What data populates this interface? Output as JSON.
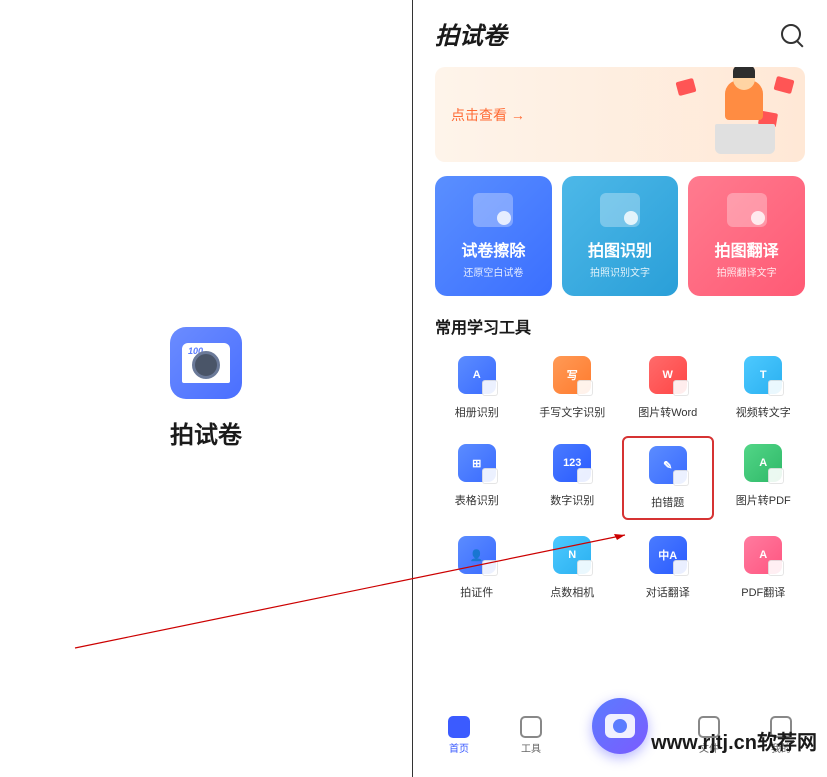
{
  "left": {
    "appName": "拍试卷"
  },
  "header": {
    "title": "拍试卷"
  },
  "banner": {
    "cta": "点击查看 →"
  },
  "featureCards": [
    {
      "title": "试卷擦除",
      "sub": "还原空白试卷",
      "color": "blue"
    },
    {
      "title": "拍图识别",
      "sub": "拍照识别文字",
      "color": "cyan"
    },
    {
      "title": "拍图翻译",
      "sub": "拍照翻译文字",
      "color": "pink"
    }
  ],
  "toolsHeader": "常用学习工具",
  "tools": [
    {
      "label": "相册识别",
      "color": "blue",
      "glyph": "A",
      "highlighted": false
    },
    {
      "label": "手写文字识别",
      "color": "orange",
      "glyph": "写",
      "highlighted": false
    },
    {
      "label": "图片转Word",
      "color": "red",
      "glyph": "W",
      "highlighted": false
    },
    {
      "label": "视频转文字",
      "color": "cyan",
      "glyph": "T",
      "highlighted": false
    },
    {
      "label": "表格识别",
      "color": "blue",
      "glyph": "⊞",
      "highlighted": false
    },
    {
      "label": "数字识别",
      "color": "darkblue",
      "glyph": "123",
      "highlighted": false
    },
    {
      "label": "拍错题",
      "color": "blue",
      "glyph": "✎",
      "highlighted": true
    },
    {
      "label": "图片转PDF",
      "color": "green",
      "glyph": "A",
      "highlighted": false
    },
    {
      "label": "拍证件",
      "color": "blue",
      "glyph": "👤",
      "highlighted": false
    },
    {
      "label": "点数相机",
      "color": "cyan",
      "glyph": "N",
      "highlighted": false
    },
    {
      "label": "对话翻译",
      "color": "darkblue",
      "glyph": "中A",
      "highlighted": false
    },
    {
      "label": "PDF翻译",
      "color": "pink",
      "glyph": "A",
      "highlighted": false
    }
  ],
  "nav": {
    "items": [
      {
        "label": "首页",
        "active": true
      },
      {
        "label": "工具",
        "active": false
      },
      {
        "label": "文件",
        "active": false
      },
      {
        "label": "我的",
        "active": false
      }
    ]
  },
  "watermark": "www.rjtj.cn软荐网"
}
